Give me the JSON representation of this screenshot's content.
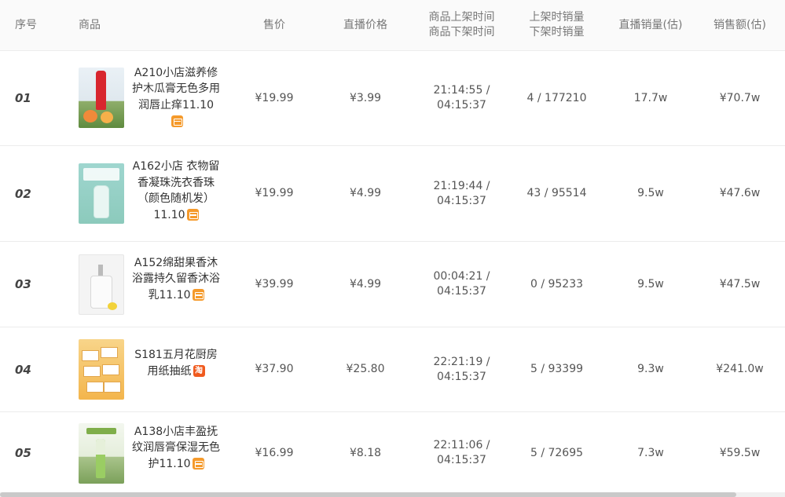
{
  "headers": {
    "index": "序号",
    "product": "商品",
    "price": "售价",
    "live_price": "直播价格",
    "time_line1": "商品上架时间",
    "time_line2": "商品下架时间",
    "sales_line1": "上架时销量",
    "sales_line2": "下架时销量",
    "live_sales": "直播销量(估)",
    "gmv": "销售额(估)"
  },
  "rows": [
    {
      "index": "01",
      "title": "A210小店滋养修护木瓜膏无色多用润唇止痒11.10",
      "badge": "store-icon",
      "price": "¥19.99",
      "live_price": "¥3.99",
      "time_on": "21:14:55 /",
      "time_off": "04:15:37",
      "sales": "4 / 177210",
      "live_sales": "17.7w",
      "gmv": "¥70.7w"
    },
    {
      "index": "02",
      "title": "A162小店 衣物留香凝珠洗衣香珠（颜色随机发）11.10",
      "badge": "store-icon",
      "price": "¥19.99",
      "live_price": "¥4.99",
      "time_on": "21:19:44 /",
      "time_off": "04:15:37",
      "sales": "43 / 95514",
      "live_sales": "9.5w",
      "gmv": "¥47.6w"
    },
    {
      "index": "03",
      "title": "A152绵甜果香沐浴露持久留香沐浴乳11.10",
      "badge": "store-icon",
      "price": "¥39.99",
      "live_price": "¥4.99",
      "time_on": "00:04:21 /",
      "time_off": "04:15:37",
      "sales": "0 / 95233",
      "live_sales": "9.5w",
      "gmv": "¥47.5w"
    },
    {
      "index": "04",
      "title": "S181五月花厨房用纸抽纸",
      "badge": "taobao-icon",
      "badge_text": "淘",
      "price": "¥37.90",
      "live_price": "¥25.80",
      "time_on": "22:21:19 /",
      "time_off": "04:15:37",
      "sales": "5 / 93399",
      "live_sales": "9.3w",
      "gmv": "¥241.0w"
    },
    {
      "index": "05",
      "title": "A138小店丰盈抚纹润唇膏保湿无色护11.10",
      "badge": "store-icon",
      "price": "¥16.99",
      "live_price": "¥8.18",
      "time_on": "22:11:06 /",
      "time_off": "04:15:37",
      "sales": "5 / 72695",
      "live_sales": "7.3w",
      "gmv": "¥59.5w"
    }
  ],
  "colors": {
    "store_badge": "#f59a2b",
    "taobao_badge": "#f05a1e",
    "header_bg": "#fafafa"
  }
}
